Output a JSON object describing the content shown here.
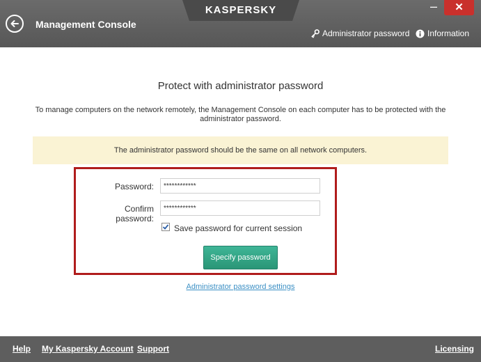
{
  "window": {
    "title": "Management Console",
    "brand": "KASPERSKY",
    "minimize": "–",
    "close": "✕"
  },
  "toolbar": {
    "admin_password": "Administrator password",
    "information": "Information"
  },
  "main": {
    "heading": "Protect with administrator password",
    "description": "To manage computers on the network remotely, the Management Console on each computer has to be protected with the administrator password.",
    "notice": "The administrator password should be the same on all network computers.",
    "password_label": "Password:",
    "password_value": "************",
    "confirm_label": "Confirm password:",
    "confirm_value": "************",
    "save_session_label": "Save password for current session",
    "save_session_checked": true,
    "specify_button": "Specify password",
    "settings_link": "Administrator password settings"
  },
  "footer": {
    "help": "Help",
    "account": "My Kaspersky Account",
    "support": "Support",
    "licensing": "Licensing"
  },
  "colors": {
    "titlebar": "#5e5e5e",
    "accent_green": "#2a9677",
    "highlight_red": "#b01c1c",
    "notice_bg": "#faf3d4",
    "link_blue": "#3b8fc4"
  }
}
